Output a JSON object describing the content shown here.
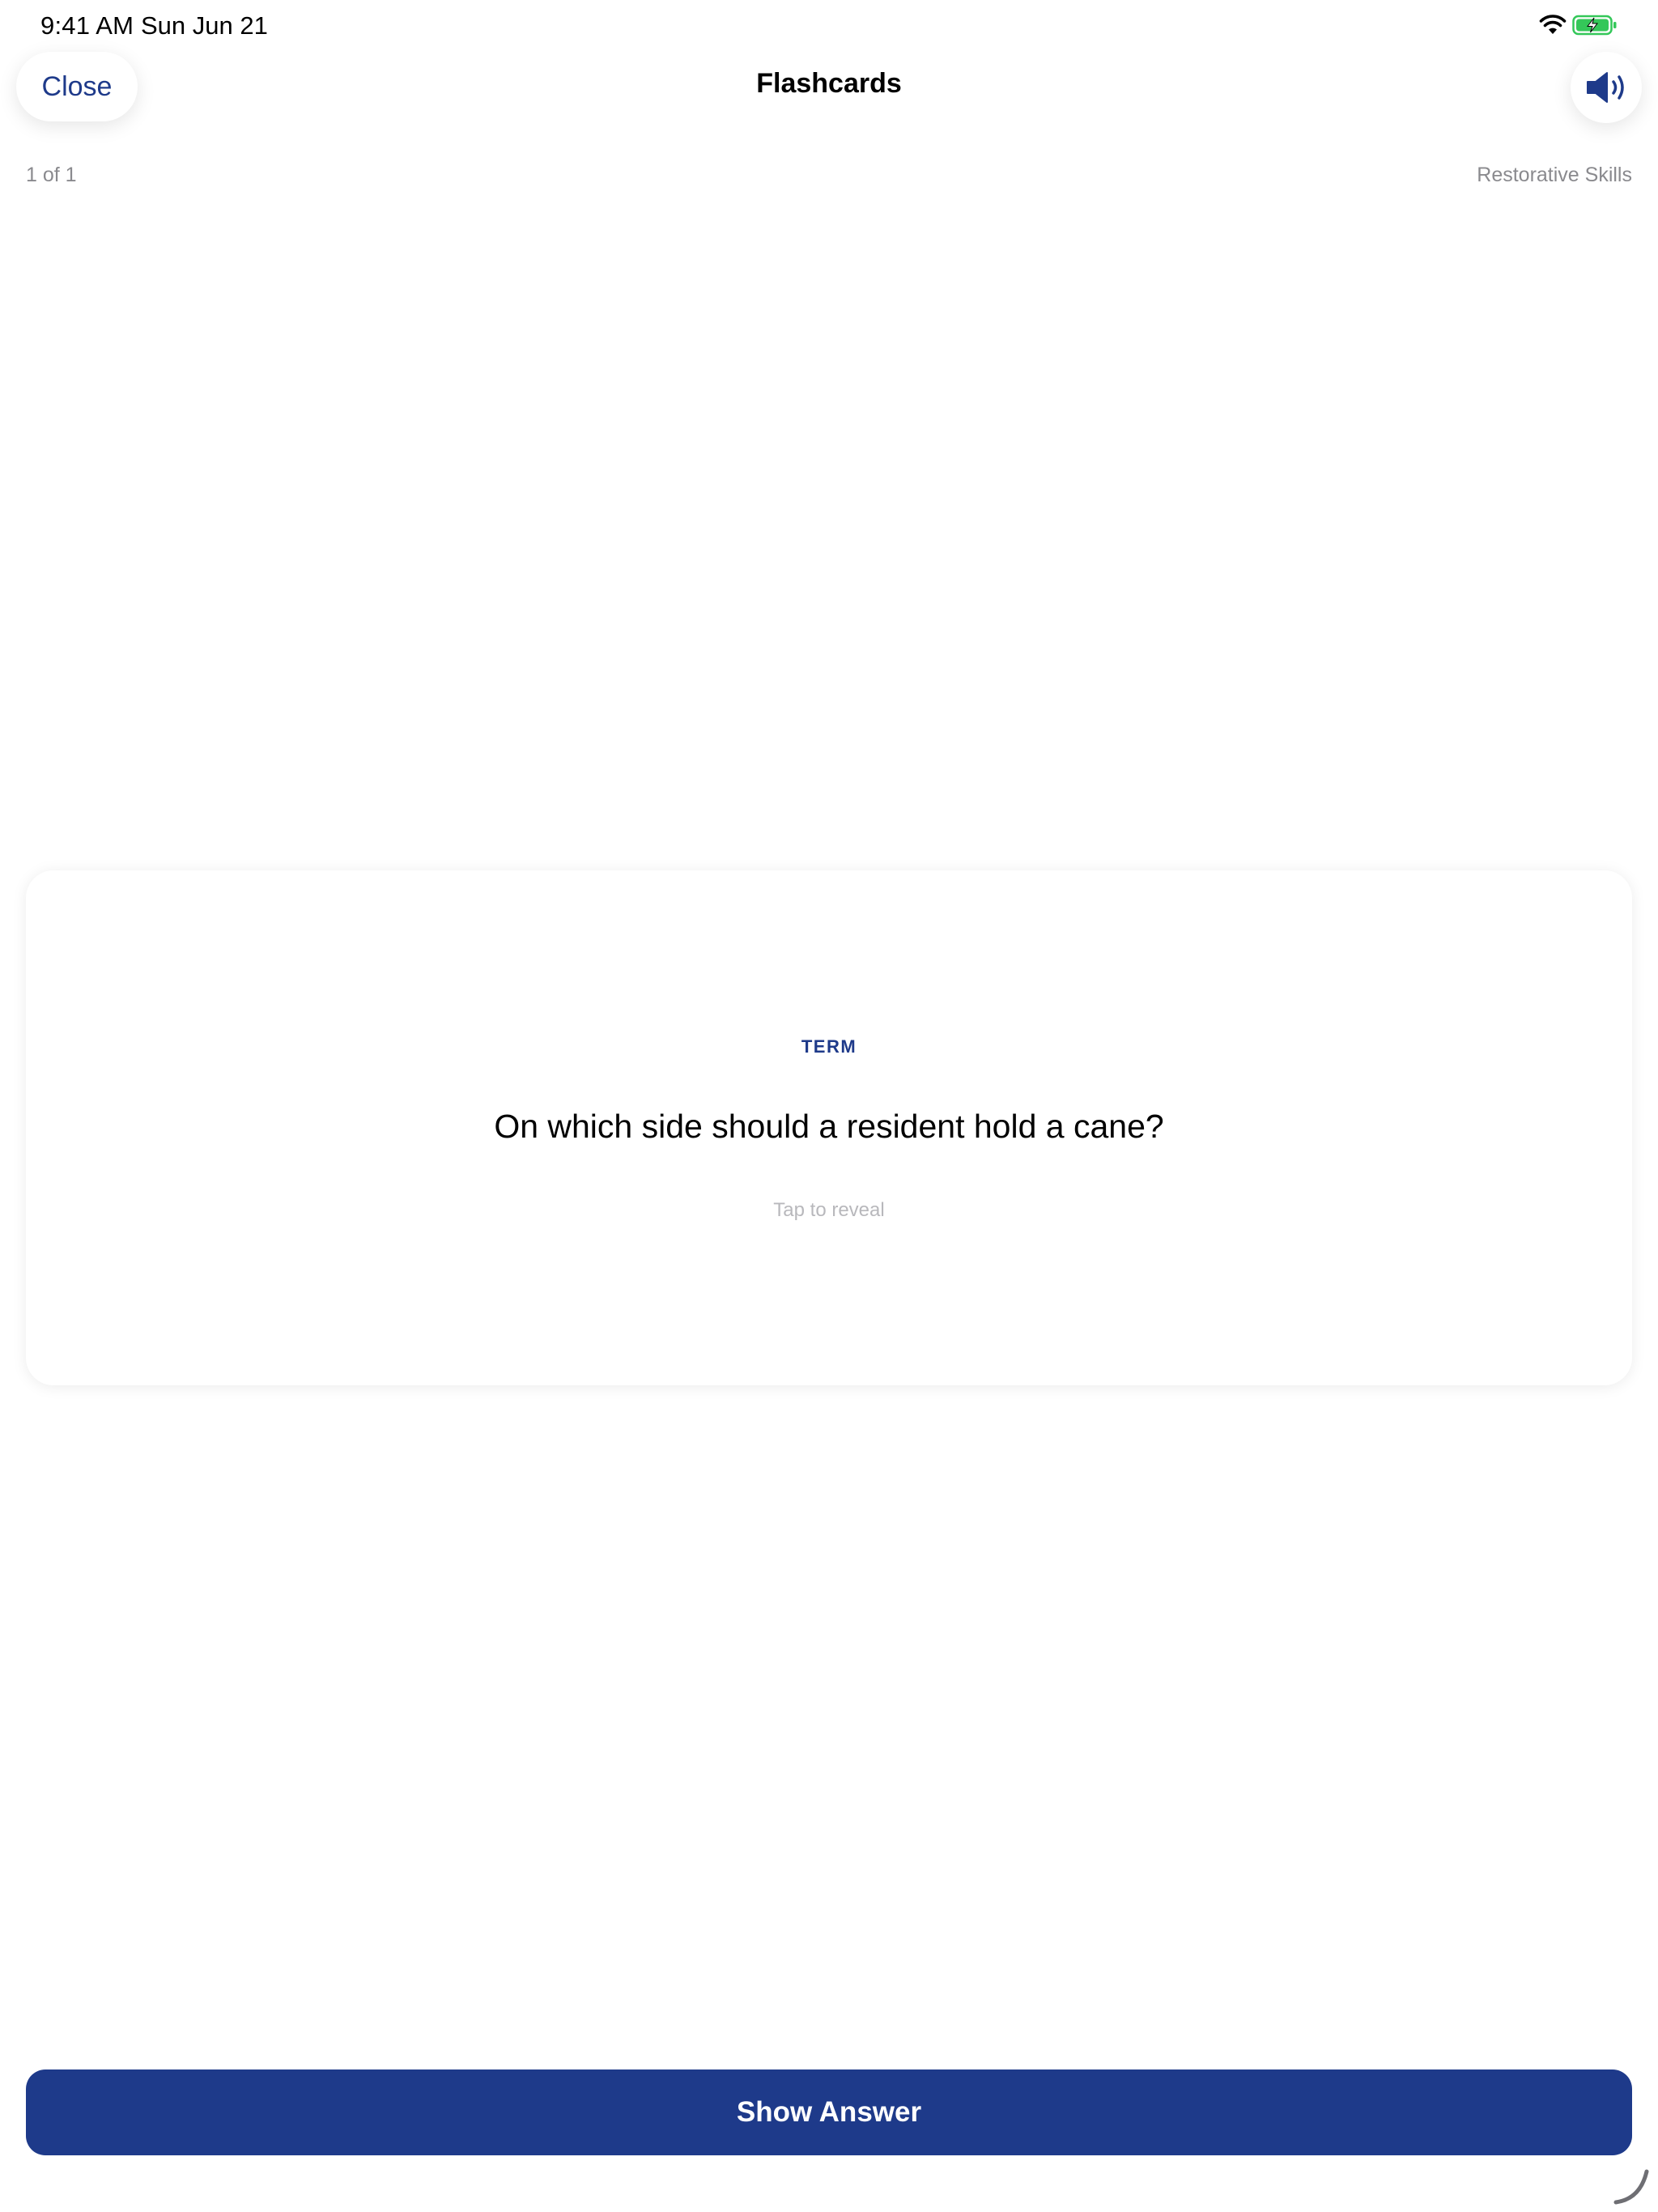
{
  "status_bar": {
    "time": "9:41 AM",
    "date": "Sun Jun 21",
    "icons": [
      "wifi-icon",
      "battery-charging-icon"
    ],
    "battery_color": "#34c759"
  },
  "nav": {
    "close_label": "Close",
    "title": "Flashcards",
    "speaker_icon": "speaker-volume-icon"
  },
  "progress": {
    "label": "1 of 1",
    "category": "Restorative Skills"
  },
  "card": {
    "kind": "TERM",
    "question": "On which side should a resident hold a cane?",
    "hint": "Tap to reveal"
  },
  "actions": {
    "show_answer_label": "Show Answer"
  },
  "colors": {
    "accent": "#1e3a8a",
    "secondary_text": "#8a8a8e",
    "hint_text": "#b8b8bc",
    "background": "#ffffff"
  }
}
